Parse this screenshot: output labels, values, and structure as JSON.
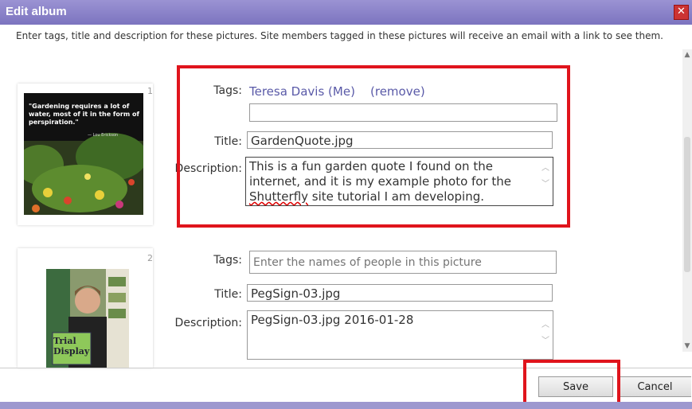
{
  "dialog": {
    "title": "Edit album",
    "close_icon": "close-icon"
  },
  "intro": "Enter tags, title and description for these pictures. Site members tagged in these pictures will receive an email with a link to see them.",
  "pictures": [
    {
      "number": "1",
      "photo_caption": "\"Gardening requires a lot of water, most of it in the form of perspiration.\"",
      "photo_author": "— Lou Erickson",
      "tags_label": "Tags:",
      "tag_person": "Teresa Davis (Me)",
      "tag_remove": "(remove)",
      "tags_value": "",
      "title_label": "Title:",
      "title_value": "GardenQuote.jpg",
      "description_label": "Description:",
      "description_line1": "This is a fun garden quote I found on the",
      "description_line2": "internet, and it is my example photo for the",
      "description_word_misspelled": "Shutterfly",
      "description_line3_rest": " site tutorial I am developing."
    },
    {
      "number": "2",
      "photo_sign_text": "Trial Display",
      "tags_label": "Tags:",
      "tags_placeholder": "Enter the names of people in this picture",
      "title_label": "Title:",
      "title_value": "PegSign-03.jpg",
      "description_label": "Description:",
      "description_value": "PegSign-03.jpg 2016-01-28"
    }
  ],
  "buttons": {
    "save": "Save",
    "cancel": "Cancel"
  },
  "colors": {
    "titlebar": "#8a83c8",
    "highlight_box": "#e0141c",
    "link": "#5a5aa8"
  }
}
